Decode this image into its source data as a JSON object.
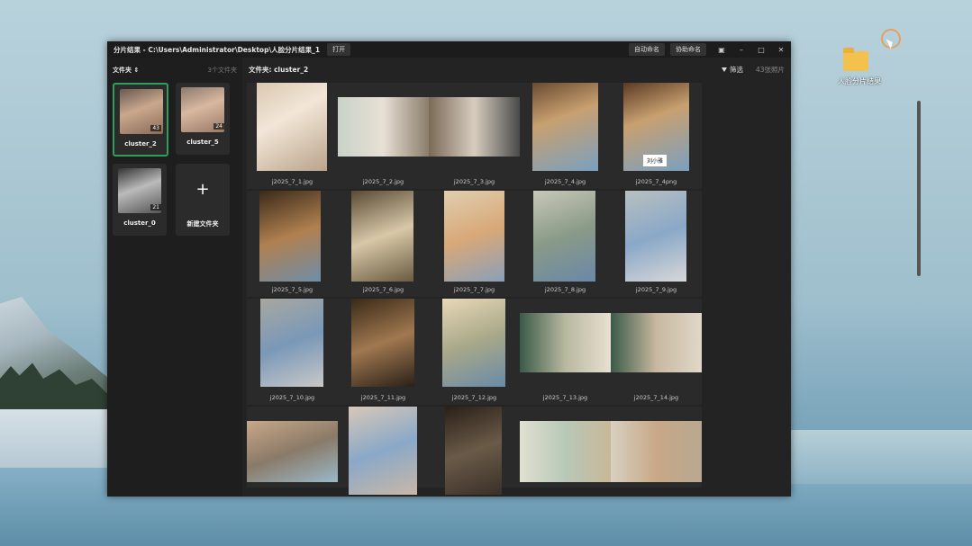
{
  "window": {
    "title": "分片结果 - C:\\Users\\Administrator\\Desktop\\人脸分片结果_1",
    "open_label": "打开",
    "auto_name_label": "自动命名",
    "assist_name_label": "协助命名"
  },
  "desktop": {
    "icon_label": "人脸分片结果"
  },
  "sidebar": {
    "header": "文件夹",
    "count": "3个文件夹",
    "folders": [
      {
        "name": "cluster_2",
        "count": "43"
      },
      {
        "name": "cluster_5",
        "count": "24"
      },
      {
        "name": "cluster_0",
        "count": "21"
      }
    ],
    "new_folder_label": "新建文件夹"
  },
  "main": {
    "title": "文件夹: cluster_2",
    "filter_label": "筛选",
    "photo_count": "43张照片",
    "tag_label": "刘小雅",
    "photos": [
      "j2025_7_1.jpg",
      "j2025_7_2.jpg",
      "j2025_7_3.jpg",
      "j2025_7_4.jpg",
      "j2025_7_4png",
      "j2025_7_5.jpg",
      "j2025_7_6.jpg",
      "j2025_7_7.jpg",
      "j2025_7_8.jpg",
      "j2025_7_9.jpg",
      "j2025_7_10.jpg",
      "j2025_7_11.jpg",
      "j2025_7_12.jpg",
      "j2025_7_13.jpg",
      "j2025_7_14.jpg",
      "",
      "",
      "",
      "",
      ""
    ]
  },
  "colors": {
    "accent": "#2f9e5a"
  }
}
